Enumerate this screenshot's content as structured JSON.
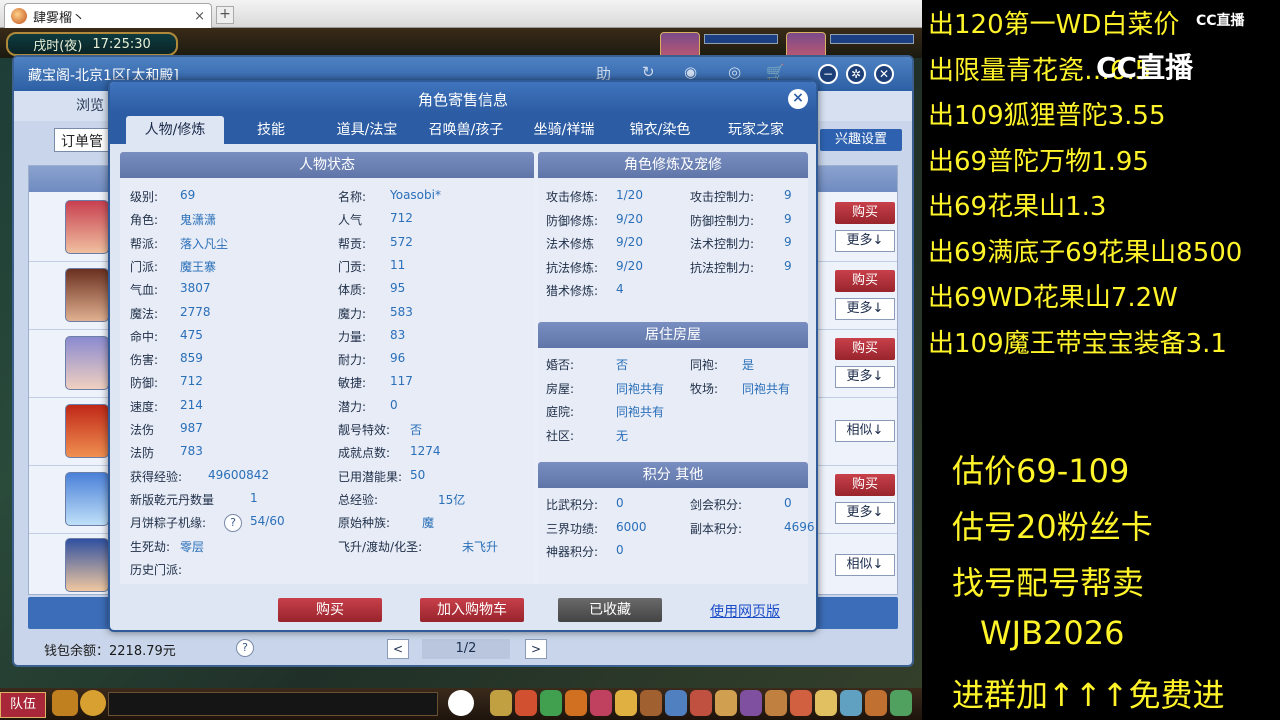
{
  "browser": {
    "tab_title": "肆雾榴丶",
    "close": "×",
    "new_tab": "+"
  },
  "game": {
    "clock_period": "戌时(夜)",
    "clock_time": "17:25:30",
    "team_label": "队伍"
  },
  "shop": {
    "title": "藏宝阁-北京1区[太和殿]",
    "icons": [
      "助",
      "↻",
      "◉",
      "◎",
      "🛒"
    ],
    "browse": "浏览",
    "order": "订单管",
    "interest": "兴趣设置",
    "buy": "购买",
    "more": "更多↓",
    "similar": "相似↓",
    "wallet": "钱包余额：2218.79元",
    "help": "?",
    "page": "1/2",
    "prev": "<",
    "next": ">"
  },
  "dialog": {
    "title": "角色寄售信息",
    "close": "×",
    "tabs": [
      "人物/修炼",
      "技能",
      "道具/法宝",
      "召唤兽/孩子",
      "坐骑/祥瑞",
      "锦衣/染色",
      "玩家之家"
    ],
    "status_title": "人物状态",
    "left_col": [
      [
        "级别:",
        "69"
      ],
      [
        "角色:",
        "鬼潇潇"
      ],
      [
        "帮派:",
        "落入凡尘"
      ],
      [
        "门派:",
        "魔王寨"
      ],
      [
        "气血:",
        "3807"
      ],
      [
        "魔法:",
        "2778"
      ],
      [
        "命中:",
        "475"
      ],
      [
        "伤害:",
        "859"
      ],
      [
        "防御:",
        "712"
      ],
      [
        "速度:",
        "214"
      ],
      [
        "法伤",
        "987"
      ],
      [
        "法防",
        "783"
      ],
      [
        "获得经验:",
        "49600842"
      ],
      [
        "新版乾元丹数量",
        "1"
      ],
      [
        "月饼粽子机缘:",
        "54/60"
      ],
      [
        "生死劫:",
        "零层"
      ],
      [
        "历史门派:",
        ""
      ]
    ],
    "right_col": [
      [
        "名称:",
        "Yoasobi*"
      ],
      [
        "人气",
        "712"
      ],
      [
        "帮贡:",
        "572"
      ],
      [
        "门贡:",
        "11"
      ],
      [
        "体质:",
        "95"
      ],
      [
        "魔力:",
        "583"
      ],
      [
        "力量:",
        "83"
      ],
      [
        "耐力:",
        "96"
      ],
      [
        "敏捷:",
        "117"
      ],
      [
        "潜力:",
        "0"
      ],
      [
        "靓号特效:",
        "否"
      ],
      [
        "成就点数:",
        "1274"
      ],
      [
        "已用潜能果:",
        "50"
      ],
      [
        "总经验:",
        "15亿"
      ],
      [
        "原始种族:",
        "魔"
      ],
      [
        "飞升/渡劫/化圣:",
        "未飞升"
      ]
    ],
    "cultivation_title": "角色修炼及宠修",
    "cultivation": [
      [
        "攻击修炼:",
        "1/20",
        "攻击控制力:",
        "9"
      ],
      [
        "防御修炼:",
        "9/20",
        "防御控制力:",
        "9"
      ],
      [
        "法术修炼",
        "9/20",
        "法术控制力:",
        "9"
      ],
      [
        "抗法修炼:",
        "9/20",
        "抗法控制力:",
        "9"
      ],
      [
        "猎术修炼:",
        "4",
        "",
        ""
      ]
    ],
    "house_title": "居住房屋",
    "house": [
      [
        "婚否:",
        "否",
        "同袍:",
        "是"
      ],
      [
        "房屋:",
        "同袍共有",
        "牧场:",
        "同袍共有"
      ],
      [
        "庭院:",
        "同袍共有",
        "",
        ""
      ],
      [
        "社区:",
        "无",
        "",
        ""
      ]
    ],
    "points_title": "积分 其他",
    "points": [
      [
        "比武积分:",
        "0",
        "剑会积分:",
        "0"
      ],
      [
        "三界功绩:",
        "6000",
        "副本积分:",
        "4696"
      ],
      [
        "神器积分:",
        "0",
        "",
        ""
      ]
    ],
    "btn_buy": "购买",
    "btn_cart": "加入购物车",
    "btn_fav": "已收藏",
    "web": "使用网页版",
    "help": "?"
  },
  "stream": {
    "logo_small": "CC直播",
    "logo_big": "CC直播",
    "lines": [
      "出120第一WD白菜价",
      "出限量青花瓷…6.5",
      "出109狐狸普陀3.55",
      "出69普陀万物1.95",
      "出69花果山1.3",
      "出69满底子69花果山8500",
      "出69WD花果山7.2W",
      "出109魔王带宝宝装备3.1"
    ],
    "bottom": [
      "估价69-109",
      "估号20粉丝卡",
      "找号配号帮卖",
      "WJB2026",
      "进群加↑↑↑免费进"
    ]
  }
}
